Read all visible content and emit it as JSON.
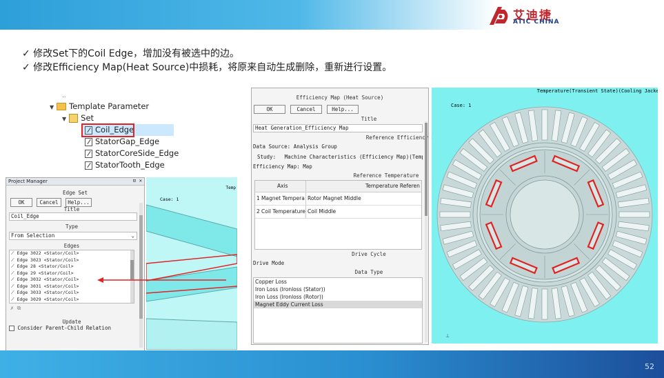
{
  "header": {
    "logo_cn": "艾迪捷",
    "logo_en": "ATIC CHINA"
  },
  "bullets": [
    "✓ 修改Set下的Coil Edge，增加没有被选中的边。",
    "✓ 修改Efficiency Map(Heat Source)中损耗，将原来自动生成删除，重新进行设置。"
  ],
  "tree": {
    "template_parameter": "Template Parameter",
    "set": "Set",
    "items": [
      "Coil_Edge",
      "StatorGap_Edge",
      "StatorCoreSide_Edge",
      "StatorTooth_Edge"
    ]
  },
  "project_manager": {
    "title": "Project Manager",
    "panel_title": "Edge Set",
    "ok": "OK",
    "cancel": "Cancel",
    "help": "Help...",
    "title_label": "Title",
    "title_value": "Coil_Edge",
    "type_label": "Type",
    "type_value": "From Selection",
    "edges_label": "Edges",
    "edges": [
      "Edge 3022 <Stator/Coil>",
      "Edge 3023 <Stator/Coil>",
      "Edge 28 <Stator/Coil>",
      "Edge 29 <Stator/Coil>",
      "Edge 3032 <Stator/Coil>",
      "Edge 3031 <Stator/Coil>",
      "Edge 3033 <Stator/Coil>",
      "Edge 3029 <Stator/Coil>"
    ],
    "update_label": "Update",
    "checkbox_label": "Consider Parent-Child Relation"
  },
  "small_view": {
    "case": "Case: 1",
    "corner": "Temp"
  },
  "efficiency": {
    "title": "Efficiency Map (Heat Source)",
    "ok": "OK",
    "cancel": "Cancel",
    "help": "Help...",
    "title_label": "Title",
    "title_value": "Heat Generation_Efficiency Map",
    "ref_eff_label": "Reference Efficiency Map",
    "data_source": "Data Source:",
    "data_source_value": "Analysis Group",
    "study": "Study:",
    "study_value": "Machine Characteristics (Efficiency Map)(Temp",
    "eff_map": "Efficiency Map:",
    "eff_map_value": "Map",
    "ref_temp_label": "Reference Temperature",
    "col_axis": "Axis",
    "col_ref": "Temperature Referen",
    "rows": [
      {
        "idx": "1",
        "axis": "Magnet Tempera",
        "ref": "Rotor Magnet Middle"
      },
      {
        "idx": "2",
        "axis": "Coil Temperature",
        "ref": "Coil Middle"
      }
    ],
    "drive_cycle_label": "Drive Cycle",
    "drive_mode": "Drive Mode",
    "data_type_label": "Data Type",
    "data_types": [
      "Copper Loss",
      "Iron Loss (Ironloss (Stator))",
      "Iron Loss (Ironloss (Rotor))",
      "Magnet Eddy Current Loss"
    ]
  },
  "motor_view": {
    "title": "Temperature(Transient State)(Cooling Jacket",
    "case": "Case: 1"
  },
  "footer": {
    "page": "52"
  },
  "colors": {
    "accent_blue": "#2d9fd9",
    "highlight_red": "#e02424",
    "teal_bg": "#7ff0f0",
    "motor_fill": "#c8d8d8"
  }
}
